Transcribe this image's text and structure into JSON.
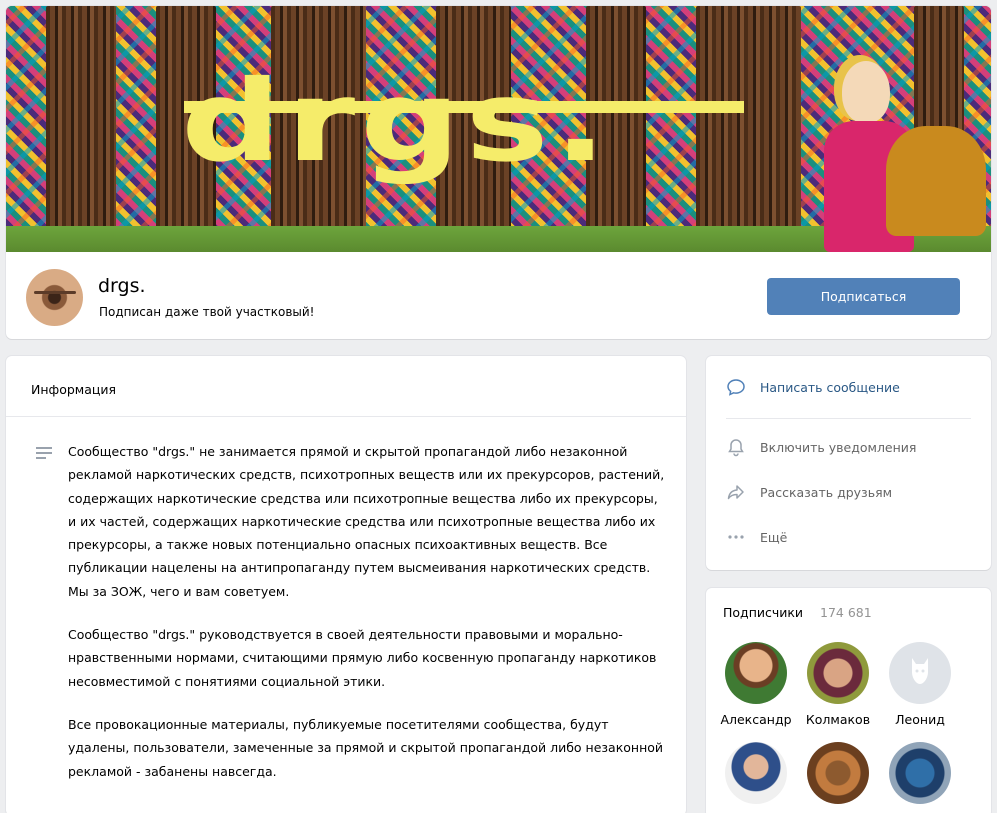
{
  "cover": {
    "logo_text": "drgs."
  },
  "group": {
    "name": "drgs.",
    "status": "Подписан даже твой участковый!",
    "subscribe_label": "Подписаться"
  },
  "info": {
    "title": "Информация",
    "paragraphs": [
      "Сообщество \"drgs.\" не занимается прямой и скрытой пропагандой либо незаконной рекламой наркотических средств, психотропных веществ или их прекурсоров, растений, содержащих наркотические средства или психотропные вещества либо их прекурсоры, и их частей, содержащих наркотические средства или психотропные вещества либо их прекурсоры, а также новых потенциально опасных психоактивных веществ. Все публикации нацелены на антипропаганду путем высмеивания наркотических средств. Мы за ЗОЖ, чего и вам советуем.",
      "Сообщество \"drgs.\" руководствуется в своей деятельности правовыми и морально-нравственными нормами, считающими прямую либо косвенную пропаганду наркотиков несовместимой с понятиями социальной этики.",
      "Все провокационные материалы, публикуемые посетителями сообщества, будут удалены, пользователи, замеченные за прямой и скрытой пропагандой либо незаконной рекламой - забанены навсегда."
    ]
  },
  "actions": {
    "message": "Написать сообщение",
    "notify": "Включить уведомления",
    "share": "Рассказать друзьям",
    "more": "Ещё"
  },
  "subscribers": {
    "title": "Подписчики",
    "count": "174 681",
    "people": [
      "Александр",
      "Колмаков",
      "Леонид"
    ]
  },
  "icons": [
    "message-icon",
    "bell-icon",
    "share-icon",
    "more-icon",
    "dog-placeholder-icon",
    "info-lines-icon"
  ],
  "colors": {
    "accent": "#5181b8",
    "link": "#2a5885",
    "logo_yellow": "#f5ec6a"
  }
}
